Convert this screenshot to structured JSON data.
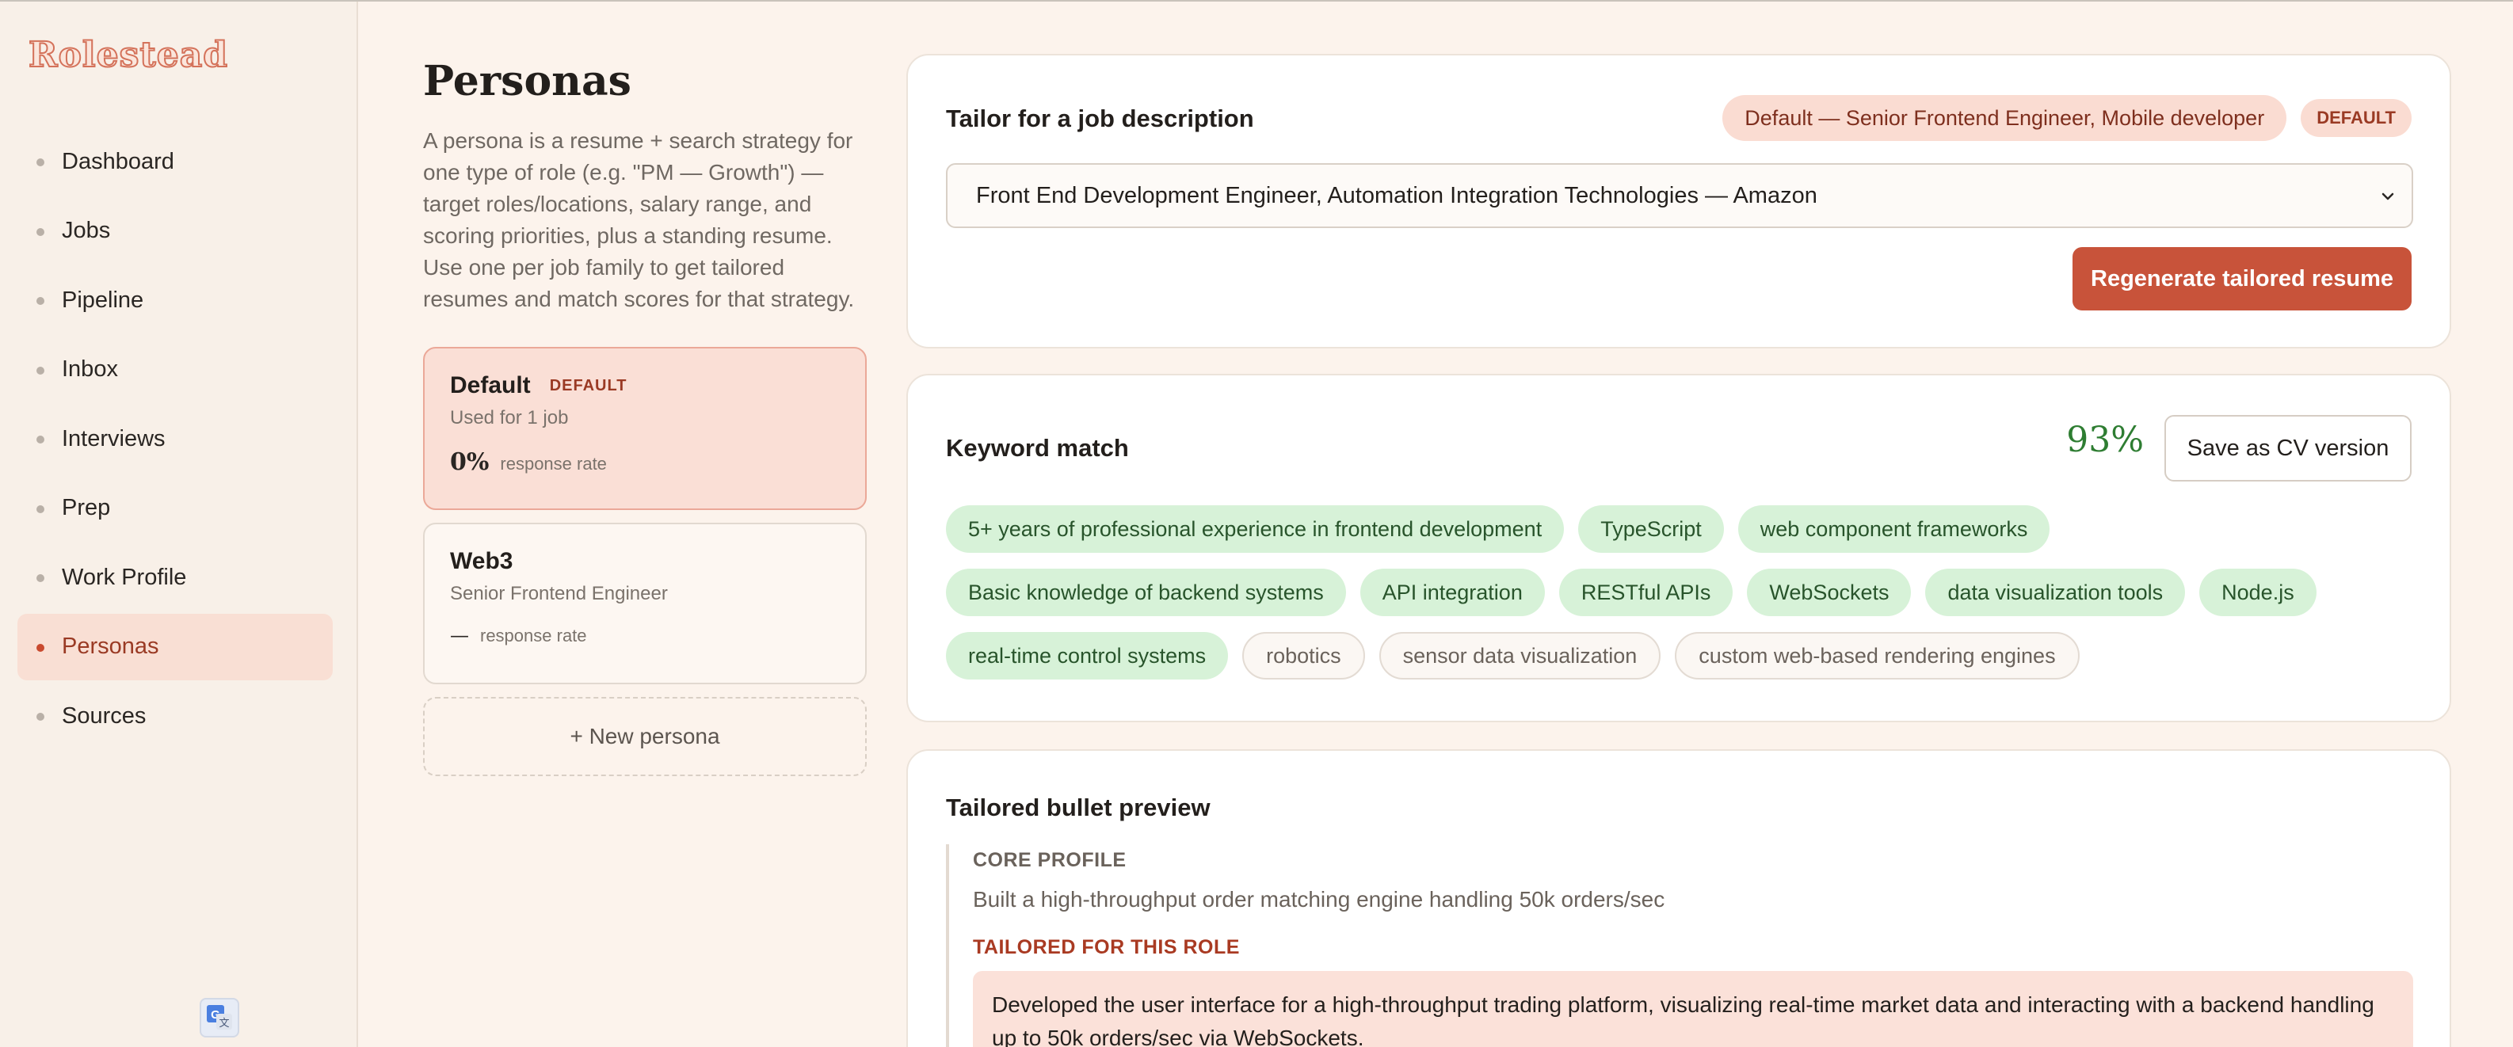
{
  "app": {
    "name": "Rolestead"
  },
  "sidebar": {
    "items": [
      {
        "label": "Dashboard"
      },
      {
        "label": "Jobs"
      },
      {
        "label": "Pipeline"
      },
      {
        "label": "Inbox"
      },
      {
        "label": "Interviews"
      },
      {
        "label": "Prep"
      },
      {
        "label": "Work Profile"
      },
      {
        "label": "Personas",
        "active": true
      },
      {
        "label": "Sources"
      }
    ]
  },
  "page": {
    "title": "Personas",
    "description": "A persona is a resume + search strategy for one type of role (e.g. \"PM — Growth\") — target roles/locations, salary range, and scoring priorities, plus a standing resume. Use one per job family to get tailored resumes and match scores for that strategy."
  },
  "personas": [
    {
      "name": "Default",
      "badge": "DEFAULT",
      "subtitle": "Used for 1 job",
      "rate": "0%",
      "rate_label": "response rate",
      "selected": true
    },
    {
      "name": "Web3",
      "subtitle": "Senior Frontend Engineer",
      "rate": "—",
      "rate_label": "response rate",
      "selected": false
    }
  ],
  "new_persona_label": "+ New persona",
  "tailor": {
    "title": "Tailor for a job description",
    "persona_chip": "Default — Senior Frontend Engineer, Mobile developer",
    "default_badge": "DEFAULT",
    "selected_job": "Front End Development Engineer, Automation Integration Technologies — Amazon",
    "regenerate_label": "Regenerate tailored resume"
  },
  "keyword_match": {
    "title": "Keyword match",
    "score": "93%",
    "save_label": "Save as CV version",
    "rows": [
      [
        {
          "text": "5+ years of professional experience in frontend development",
          "matched": true
        },
        {
          "text": "TypeScript",
          "matched": true
        },
        {
          "text": "web component frameworks",
          "matched": true
        }
      ],
      [
        {
          "text": "Basic knowledge of backend systems",
          "matched": true
        },
        {
          "text": "API integration",
          "matched": true
        },
        {
          "text": "RESTful APIs",
          "matched": true
        },
        {
          "text": "WebSockets",
          "matched": true
        },
        {
          "text": "data visualization tools",
          "matched": true
        },
        {
          "text": "Node.js",
          "matched": true
        }
      ],
      [
        {
          "text": "real-time control systems",
          "matched": true
        },
        {
          "text": "robotics",
          "matched": false
        },
        {
          "text": "sensor data visualization",
          "matched": false
        },
        {
          "text": "custom web-based rendering engines",
          "matched": false
        }
      ]
    ]
  },
  "bullet_preview": {
    "title": "Tailored bullet preview",
    "core_label": "CORE PROFILE",
    "core_text": "Built a high-throughput order matching engine handling 50k orders/sec",
    "tailored_label": "TAILORED FOR THIS ROLE",
    "tailored_text": "Developed the user interface for a high-throughput trading platform, visualizing real-time market data and interacting with a backend handling up to 50k orders/sec via WebSockets."
  },
  "colors": {
    "accent": "#c8533a",
    "match_chip": "#d7f2d8",
    "score": "#2e7d32",
    "selected_persona": "#fadfd6"
  }
}
